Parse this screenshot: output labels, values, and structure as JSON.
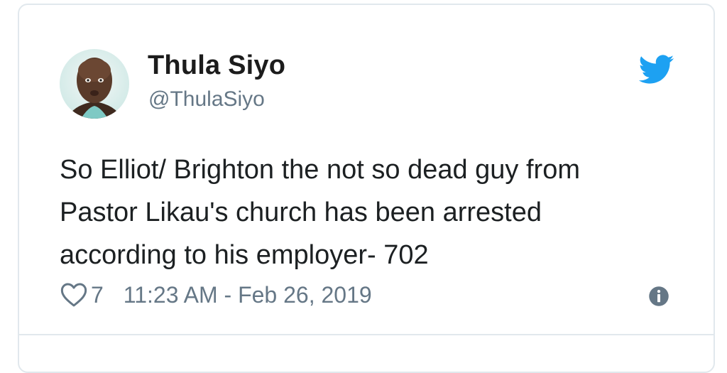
{
  "tweet": {
    "author_name": "Thula Siyo",
    "author_handle": "@ThulaSiyo",
    "text_lines": [
      "So Elliot/ Brighton the not so dead guy from",
      "Pastor Likau's church has been arrested",
      "according to his employer- 702"
    ],
    "like_count": "7",
    "timestamp": "11:23 AM - Feb 26, 2019"
  },
  "icons": {
    "brand": "twitter-bird-icon",
    "like": "heart-icon",
    "info": "info-icon"
  },
  "colors": {
    "twitter_blue": "#1da1f2",
    "secondary_text": "#657786",
    "border": "#e1e8ed"
  }
}
